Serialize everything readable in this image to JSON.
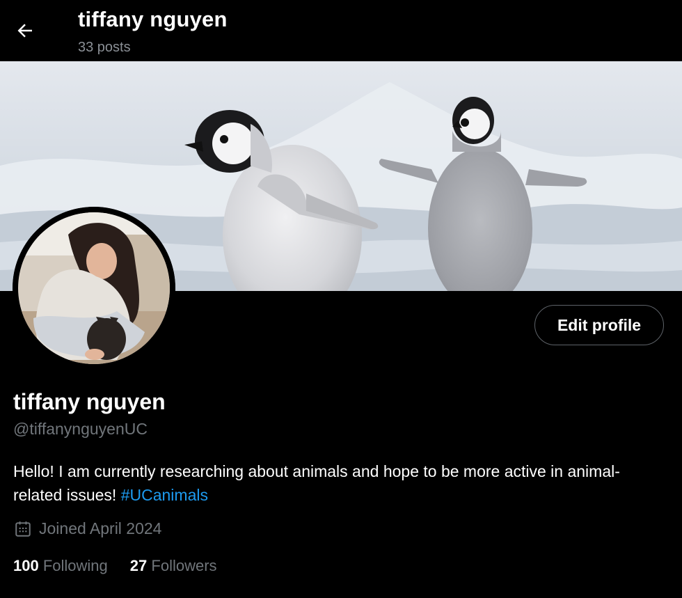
{
  "header": {
    "title": "tiffany nguyen",
    "post_count": "33 posts"
  },
  "profile": {
    "display_name": "tiffany nguyen",
    "handle": "@tiffanynguyenUC",
    "bio_text": "Hello! I am currently researching about animals and hope to be more active in animal-related issues! ",
    "bio_hashtag": "#UCanimals",
    "joined": "Joined April 2024",
    "edit_label": "Edit profile",
    "following_count": "100",
    "following_label": "Following",
    "followers_count": "27",
    "followers_label": "Followers"
  },
  "icons": {
    "back": "arrow-left-icon",
    "calendar": "calendar-icon"
  },
  "colors": {
    "background": "#000000",
    "link": "#1d9bf0",
    "secondary_text": "#71767b"
  }
}
